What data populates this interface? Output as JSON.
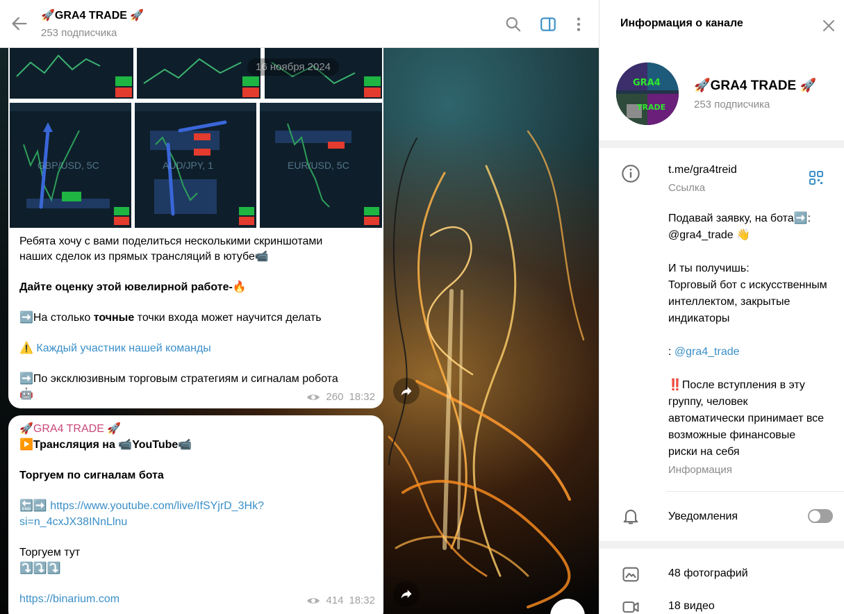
{
  "header": {
    "title": "🚀GRA4 TRADE 🚀",
    "subtitle": "253 подписчика"
  },
  "date_pill": "16 ноября 2024",
  "icons": {
    "back": "arrow-left-icon",
    "search": "search-icon",
    "sidebar": "sidebar-toggle-icon",
    "more": "more-vertical-icon",
    "close": "close-icon",
    "info": "info-icon",
    "qr": "qr-code-icon",
    "bell": "bell-icon",
    "photo": "photo-icon",
    "video": "video-icon",
    "eye": "eye-icon",
    "forward": "forward-icon"
  },
  "colors": {
    "accent": "#3a8fc8",
    "author": "#c9487a",
    "muted": "#8a8a8a",
    "chart_bg": "#0e1f2b",
    "btn_up": "#1fb543",
    "btn_down": "#e33b2e"
  },
  "screenshots": {
    "labels": [
      "GBP/USD, 5C",
      "AUD/JPY, 1",
      "EUR/USD, 5C"
    ]
  },
  "message1": {
    "line1": "Ребята хочу с вами поделиться несколькими скриншотами",
    "line2": "наших сделок из прямых трансляций в ютубе📹",
    "bold_line": "Дайте оценку этой ювелирной работе-🔥",
    "accurate_pre": "➡️На столько ",
    "accurate_bold": "точные",
    "accurate_post": " точки входа может научится делать",
    "warning_icon": "⚠️",
    "warning_link": "Каждый участник нашей команды",
    "strategies": "➡️По эксклюзивным торговым стратегиям и сигналам робота",
    "robot": "🤖",
    "views": "260",
    "time": "18:32"
  },
  "message2": {
    "author": "🚀GRA4 TRADE 🚀",
    "stream": "▶️Трансляция на 📹YouTube📹",
    "trade_by_bot": "Торгуем по сигналам бота",
    "arrows": "🔚➡️",
    "yt_link_1": "https://www.youtube.com/live/IfSYjrD_3Hk?",
    "yt_link_2": "si=n_4cxJX38INnLlnu",
    "trade_here": "Торгуем тут",
    "down_arrows": "⤵️⤵️⤵️",
    "site_link": "https://binarium.com",
    "views": "414",
    "time": "18:32"
  },
  "info": {
    "title": "Информация о канале",
    "channel_name": "🚀GRA4 TRADE 🚀",
    "subscribers": "253 подписчика",
    "avatar_text_top": "GRA4",
    "avatar_text_bottom": "TRADE",
    "link": "t.me/gra4treid",
    "link_label": "Ссылка",
    "desc_1": "Подавай заявку,  на бота➡️:",
    "desc_2": "@gra4_trade 👋",
    "desc_3": "И ты получишь:",
    "desc_4": "Торговый бот с искусственным",
    "desc_5": "интеллектом, закрытые",
    "desc_6": "индикаторы",
    "desc_7_prefix": ": ",
    "desc_7_link": "@gra4_trade",
    "desc_8": "‼️После вступления в эту",
    "desc_9": "группу, человек",
    "desc_10": "автоматически принимает все",
    "desc_11": "возможные финансовые",
    "desc_12": "риски на себя",
    "desc_label": "Информация",
    "notifications": "Уведомления",
    "notifications_on": false,
    "photos": "48 фотографий",
    "videos": "18 видео"
  }
}
